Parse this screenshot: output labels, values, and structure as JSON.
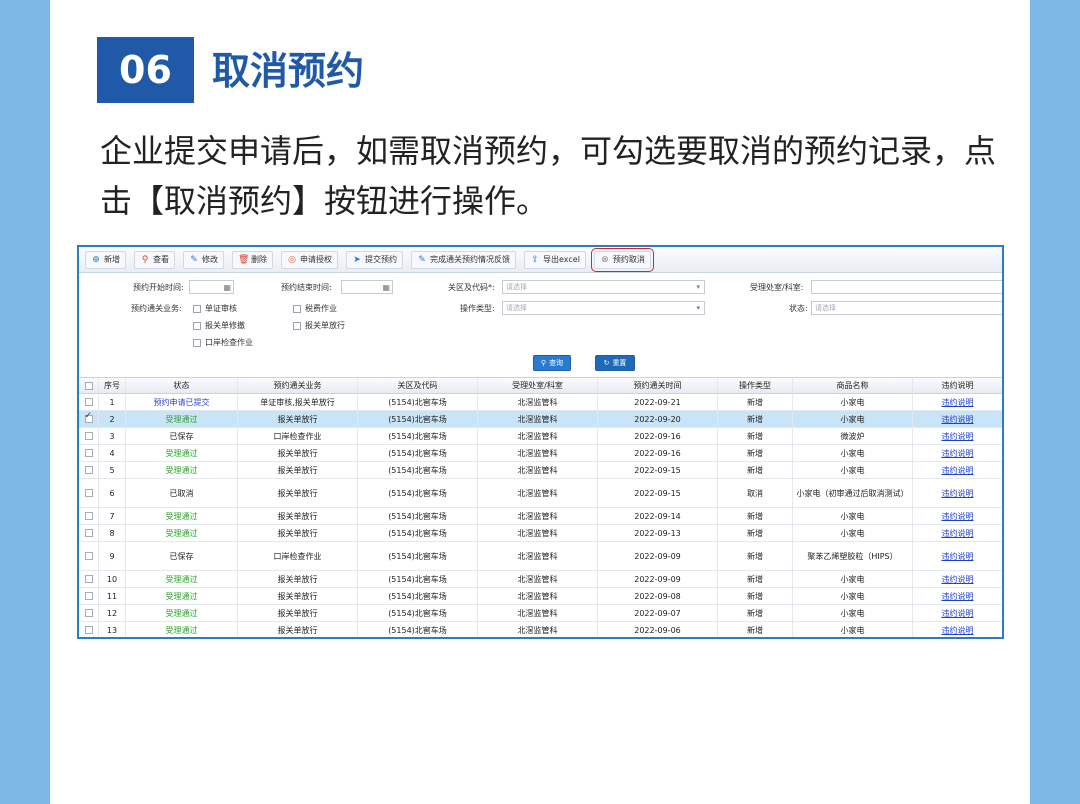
{
  "section": {
    "number": "06",
    "title": "取消预约"
  },
  "description": "企业提交申请后，如需取消预约，可勾选要取消的预约记录，点击【取消预约】按钮进行操作。",
  "toolbar": [
    {
      "label": "新增",
      "icon": "plus-circle-icon",
      "glyph": "⊕",
      "color": "#2a7bd0"
    },
    {
      "label": "查看",
      "icon": "search-icon",
      "glyph": "⚲",
      "color": "#d9422b"
    },
    {
      "label": "修改",
      "icon": "edit-icon",
      "glyph": "✎",
      "color": "#2a7bd0"
    },
    {
      "label": "删除",
      "icon": "trash-icon",
      "glyph": "🗑",
      "color": "#d9422b"
    },
    {
      "label": "申请授权",
      "icon": "authorize-icon",
      "glyph": "◎",
      "color": "#e0632d"
    },
    {
      "label": "提交预约",
      "icon": "send-icon",
      "glyph": "➤",
      "color": "#2a7bd0"
    },
    {
      "label": "完成通关预约情况反馈",
      "icon": "feedback-icon",
      "glyph": "✎",
      "color": "#2a7bd0"
    },
    {
      "label": "导出excel",
      "icon": "export-icon",
      "glyph": "⇪",
      "color": "#2a7bd0"
    },
    {
      "label": "预约取消",
      "icon": "cancel-icon",
      "glyph": "⊗",
      "color": "#888888"
    }
  ],
  "filters": {
    "start_label": "预约开始时间:",
    "end_label": "预约结束时间:",
    "customs_label": "关区及代码*:",
    "customs_placeholder": "请选择",
    "office_label": "受理处室/科室:",
    "business_label": "预约通关业务:",
    "op_type_label": "操作类型:",
    "op_type_placeholder": "请选择",
    "status_label": "状态:",
    "status_placeholder": "请选择",
    "checkboxes": [
      "单证审核",
      "税费作业",
      "报关单修撤",
      "报关单放行",
      "口岸检查作业"
    ],
    "query_label": "查询",
    "reset_label": "重置"
  },
  "table": {
    "headers": [
      "序号",
      "状态",
      "预约通关业务",
      "关区及代码",
      "受理处室/科室",
      "预约通关时间",
      "操作类型",
      "商品名称",
      "违约说明"
    ],
    "rows": [
      {
        "seq": "1",
        "status": "预约申请已提交",
        "status_color": "blue",
        "biz": "单证审核,报关单放行",
        "customs": "(5154)北窖车场",
        "office": "北滘监管科",
        "time": "2022-09-21",
        "op": "新增",
        "goods": "小家电",
        "vio": "违约说明",
        "checked": false
      },
      {
        "seq": "2",
        "status": "受理通过",
        "status_color": "green",
        "biz": "报关单放行",
        "customs": "(5154)北窖车场",
        "office": "北滘监管科",
        "time": "2022-09-20",
        "op": "新增",
        "goods": "小家电",
        "vio": "违约说明",
        "checked": true
      },
      {
        "seq": "3",
        "status": "已保存",
        "status_color": "black",
        "biz": "口岸检查作业",
        "customs": "(5154)北窖车场",
        "office": "北滘监管科",
        "time": "2022-09-16",
        "op": "新增",
        "goods": "微波炉",
        "vio": "违约说明",
        "checked": false
      },
      {
        "seq": "4",
        "status": "受理通过",
        "status_color": "green",
        "biz": "报关单放行",
        "customs": "(5154)北窖车场",
        "office": "北滘监管科",
        "time": "2022-09-16",
        "op": "新增",
        "goods": "小家电",
        "vio": "违约说明",
        "checked": false
      },
      {
        "seq": "5",
        "status": "受理通过",
        "status_color": "green",
        "biz": "报关单放行",
        "customs": "(5154)北窖车场",
        "office": "北滘监管科",
        "time": "2022-09-15",
        "op": "新增",
        "goods": "小家电",
        "vio": "违约说明",
        "checked": false
      },
      {
        "seq": "6",
        "status": "已取消",
        "status_color": "black",
        "biz": "报关单放行",
        "customs": "(5154)北窖车场",
        "office": "北滘监管科",
        "time": "2022-09-15",
        "op": "取消",
        "goods": "小家电（初审通过后取消测试）",
        "vio": "违约说明",
        "checked": false
      },
      {
        "seq": "7",
        "status": "受理通过",
        "status_color": "green",
        "biz": "报关单放行",
        "customs": "(5154)北窖车场",
        "office": "北滘监管科",
        "time": "2022-09-14",
        "op": "新增",
        "goods": "小家电",
        "vio": "违约说明",
        "checked": false
      },
      {
        "seq": "8",
        "status": "受理通过",
        "status_color": "green",
        "biz": "报关单放行",
        "customs": "(5154)北窖车场",
        "office": "北滘监管科",
        "time": "2022-09-13",
        "op": "新增",
        "goods": "小家电",
        "vio": "违约说明",
        "checked": false
      },
      {
        "seq": "9",
        "status": "已保存",
        "status_color": "black",
        "biz": "口岸检查作业",
        "customs": "(5154)北窖车场",
        "office": "北滘监管科",
        "time": "2022-09-09",
        "op": "新增",
        "goods": "聚苯乙烯塑胶粒（HIPS）",
        "vio": "违约说明",
        "checked": false
      },
      {
        "seq": "10",
        "status": "受理通过",
        "status_color": "green",
        "biz": "报关单放行",
        "customs": "(5154)北窖车场",
        "office": "北滘监管科",
        "time": "2022-09-09",
        "op": "新增",
        "goods": "小家电",
        "vio": "违约说明",
        "checked": false
      },
      {
        "seq": "11",
        "status": "受理通过",
        "status_color": "green",
        "biz": "报关单放行",
        "customs": "(5154)北窖车场",
        "office": "北滘监管科",
        "time": "2022-09-08",
        "op": "新增",
        "goods": "小家电",
        "vio": "违约说明",
        "checked": false
      },
      {
        "seq": "12",
        "status": "受理通过",
        "status_color": "green",
        "biz": "报关单放行",
        "customs": "(5154)北窖车场",
        "office": "北滘监管科",
        "time": "2022-09-07",
        "op": "新增",
        "goods": "小家电",
        "vio": "违约说明",
        "checked": false
      },
      {
        "seq": "13",
        "status": "受理通过",
        "status_color": "green",
        "biz": "报关单放行",
        "customs": "(5154)北窖车场",
        "office": "北滘监管科",
        "time": "2022-09-06",
        "op": "新增",
        "goods": "小家电",
        "vio": "违约说明",
        "checked": false
      }
    ]
  },
  "colors": {
    "accent": "#1f59a8",
    "side_band": "#7db8e6",
    "frame": "#2c7cc5",
    "highlight": "#d22222",
    "selected_row": "#c9e3f7"
  }
}
